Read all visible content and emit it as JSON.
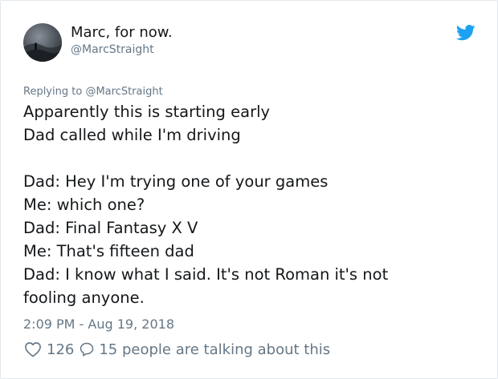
{
  "author": {
    "display_name": "Marc, for now.",
    "handle": "@MarcStraight"
  },
  "reply_context": {
    "prefix": "Replying to ",
    "mention": "@MarcStraight"
  },
  "tweet": {
    "lines": [
      "Apparently this is starting early",
      "Dad called while I'm driving",
      "",
      "Dad: Hey I'm trying one of your games",
      "Me: which one?",
      "Dad: Final Fantasy X V",
      "Me: That's fifteen dad",
      "Dad: I know what I said. It's not Roman it's not",
      "fooling anyone."
    ],
    "timestamp": "2:09 PM - Aug 19, 2018"
  },
  "engagement": {
    "likes": "126",
    "replies_text": "15 people are talking about this"
  },
  "icons": {
    "brand": "twitter-bird-icon",
    "like": "heart-icon",
    "reply": "speech-bubble-icon"
  },
  "colors": {
    "twitter_blue": "#1da1f2",
    "secondary_text": "#657786",
    "primary_text": "#14171a"
  }
}
